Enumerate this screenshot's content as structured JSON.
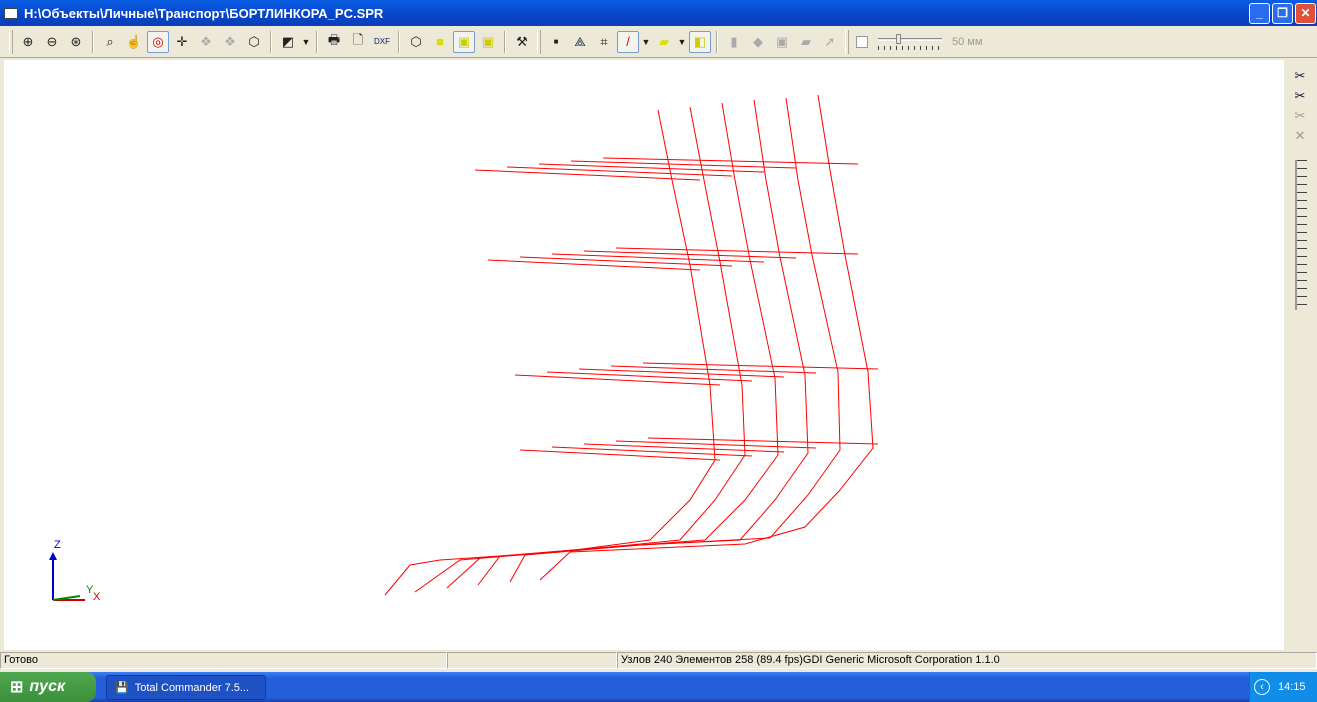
{
  "window": {
    "title": "H:\\Объекты\\Личные\\Транспорт\\БОРТЛИНКОРА_PC.SPR",
    "minimize": "_",
    "maximize": "❐",
    "close": "✕"
  },
  "toolbar": {
    "slider_label": "50 мм",
    "slider_value_mm": 50
  },
  "axes": {
    "z": "Z",
    "y": "Y",
    "x": "X"
  },
  "status": {
    "ready": "Готово",
    "empty": "",
    "info": "Узлов 240  Элементов 258  (89.4 fps)GDI Generic Microsoft Corporation 1.1.0"
  },
  "taskbar": {
    "start": "пуск",
    "task": "Total Commander 7.5...",
    "clock": "14:15"
  },
  "colors": {
    "wireframe": "#ff0000",
    "titlebar": "#0a50d8"
  }
}
